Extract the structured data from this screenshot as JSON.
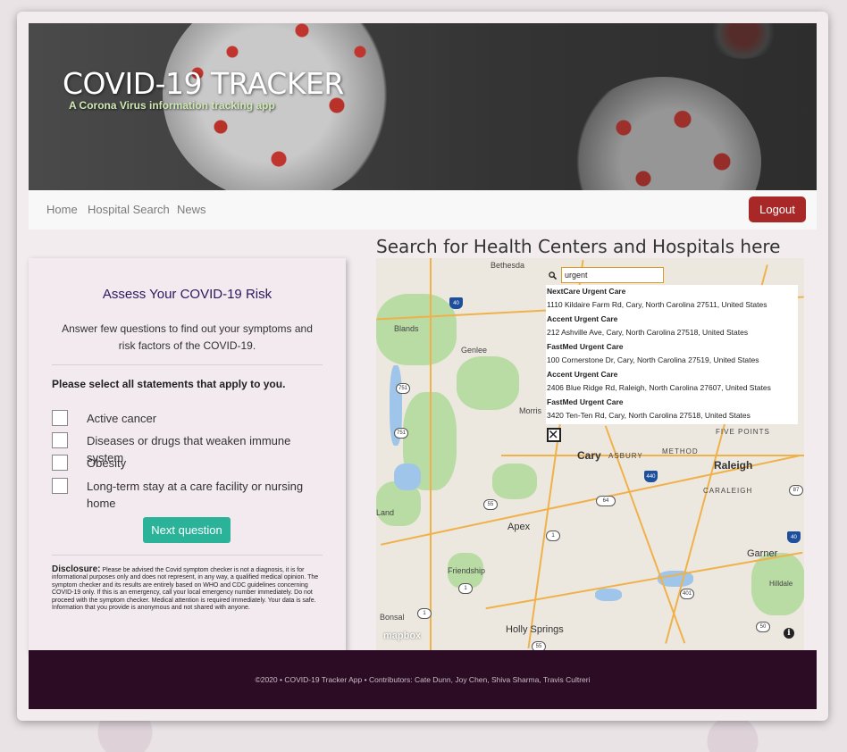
{
  "banner": {
    "title": "COVID-19 TRACKER",
    "subtitle": "A Corona Virus information tracking app"
  },
  "nav": {
    "links": [
      "Home",
      "Hospital Search",
      "News"
    ],
    "logout": "Logout"
  },
  "risk": {
    "title": "Assess Your COVID-19 Risk",
    "description": "Answer few questions to find out your symptoms and risk factors of the COVID-19.",
    "prompt": "Please select all statements that apply to you.",
    "options": [
      "Active cancer",
      "Diseases or drugs that weaken immune system",
      "Obesity",
      "Long-term stay at a care facility or nursing home"
    ],
    "next_button": "Next question",
    "disclosure_label": "Disclosure:",
    "disclosure_text": "Please be advised the Covid symptom checker is not a diagnosis, it is for informational purposes only and does not represent, in any way, a qualified medical opinion. The symptom checker and its results are entirely based on WHO and CDC guidelines concerning COVID-19 only. If this is an emergency, call your local emergency number immediately. Do not proceed with the symptom checker. Medical attention is required immediately. Your data is safe. Information that you provide is anonymous and not shared with anyone."
  },
  "map": {
    "heading": "Search for Health Centers and Hospitals here",
    "search_value": "urgent",
    "suggestions": [
      {
        "name": "NextCare Urgent Care",
        "address": "1110 Kildaire Farm Rd, Cary, North Carolina 27511, United States"
      },
      {
        "name": "Accent Urgent Care",
        "address": "212 Ashville Ave, Cary, North Carolina 27518, United States"
      },
      {
        "name": "FastMed Urgent Care",
        "address": "100 Cornerstone Dr, Cary, North Carolina 27519, United States"
      },
      {
        "name": "Accent Urgent Care",
        "address": "2406 Blue Ridge Rd, Raleigh, North Carolina 27607, United States"
      },
      {
        "name": "FastMed Urgent Care",
        "address": "3420 Ten-Ten Rd, Cary, North Carolina 27518, United States"
      }
    ],
    "places": {
      "cary": "Cary",
      "raleigh": "Raleigh",
      "apex": "Apex",
      "garner": "Garner",
      "holly_springs": "Holly Springs",
      "blands": "Blands",
      "genlee": "Genlee",
      "morris": "Morris",
      "friendship": "Friendship",
      "bonsal": "Bonsal",
      "land": "Land",
      "hilldale": "Hilldale",
      "five_points": "FIVE POINTS",
      "method": "METHOD",
      "asbury": "ASBURY",
      "carale": "CARALEIGH",
      "bethesda": "Bethesda"
    },
    "routes": [
      "40",
      "751",
      "751",
      "55",
      "1",
      "64",
      "440",
      "87",
      "40",
      "401",
      "50",
      "55",
      "1",
      "1"
    ],
    "attribution": "mapbox"
  },
  "footer": {
    "text": "©2020 • COVID-19 Tracker App • Contributors: Cate Dunn, Joy Chen, Shiva Sharma, Travis Cultreri"
  },
  "colors": {
    "logout": "#a82828",
    "next_button": "#2bb39a",
    "footer_bg": "#2b0c24",
    "title_color": "#2a1a5e"
  }
}
